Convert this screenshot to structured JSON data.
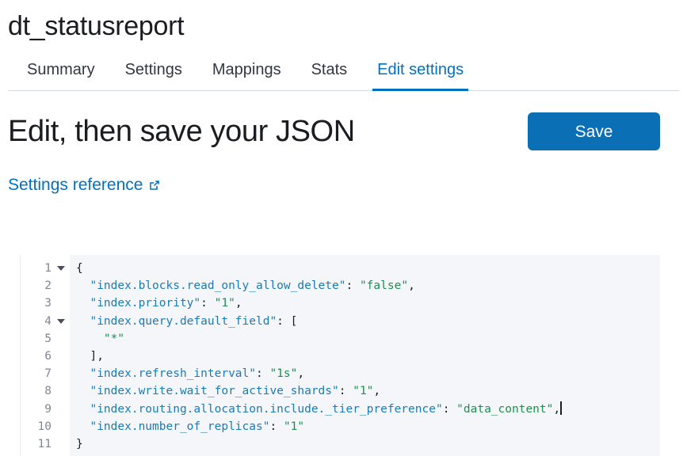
{
  "header": {
    "index_name": "dt_statusreport"
  },
  "tabs": [
    {
      "label": "Summary",
      "active": false
    },
    {
      "label": "Settings",
      "active": false
    },
    {
      "label": "Mappings",
      "active": false
    },
    {
      "label": "Stats",
      "active": false
    },
    {
      "label": "Edit settings",
      "active": true
    }
  ],
  "section": {
    "title": "Edit, then save your JSON",
    "save_label": "Save",
    "reference_link_label": "Settings reference",
    "reference_link_icon": "external-link-icon"
  },
  "editor": {
    "caret_line": 9,
    "fold_lines": [
      1,
      4
    ],
    "lines": [
      {
        "num": "1",
        "indent": 0,
        "tokens": [
          {
            "t": "p",
            "s": "{"
          }
        ]
      },
      {
        "num": "2",
        "indent": 2,
        "tokens": [
          {
            "t": "k",
            "s": "\"index.blocks.read_only_allow_delete\""
          },
          {
            "t": "p",
            "s": ": "
          },
          {
            "t": "v",
            "s": "\"false\""
          },
          {
            "t": "p",
            "s": ","
          }
        ]
      },
      {
        "num": "3",
        "indent": 2,
        "tokens": [
          {
            "t": "k",
            "s": "\"index.priority\""
          },
          {
            "t": "p",
            "s": ": "
          },
          {
            "t": "v",
            "s": "\"1\""
          },
          {
            "t": "p",
            "s": ","
          }
        ]
      },
      {
        "num": "4",
        "indent": 2,
        "tokens": [
          {
            "t": "k",
            "s": "\"index.query.default_field\""
          },
          {
            "t": "p",
            "s": ": ["
          }
        ]
      },
      {
        "num": "5",
        "indent": 4,
        "tokens": [
          {
            "t": "v",
            "s": "\"*\""
          }
        ]
      },
      {
        "num": "6",
        "indent": 2,
        "tokens": [
          {
            "t": "p",
            "s": "],"
          }
        ]
      },
      {
        "num": "7",
        "indent": 2,
        "tokens": [
          {
            "t": "k",
            "s": "\"index.refresh_interval\""
          },
          {
            "t": "p",
            "s": ": "
          },
          {
            "t": "v",
            "s": "\"1s\""
          },
          {
            "t": "p",
            "s": ","
          }
        ]
      },
      {
        "num": "8",
        "indent": 2,
        "tokens": [
          {
            "t": "k",
            "s": "\"index.write.wait_for_active_shards\""
          },
          {
            "t": "p",
            "s": ": "
          },
          {
            "t": "v",
            "s": "\"1\""
          },
          {
            "t": "p",
            "s": ","
          }
        ]
      },
      {
        "num": "9",
        "indent": 2,
        "tokens": [
          {
            "t": "k",
            "s": "\"index.routing.allocation.include._tier_preference\""
          },
          {
            "t": "p",
            "s": ": "
          },
          {
            "t": "v",
            "s": "\"data_content\""
          },
          {
            "t": "p",
            "s": ","
          }
        ]
      },
      {
        "num": "10",
        "indent": 2,
        "tokens": [
          {
            "t": "k",
            "s": "\"index.number_of_replicas\""
          },
          {
            "t": "p",
            "s": ": "
          },
          {
            "t": "v",
            "s": "\"1\""
          }
        ]
      },
      {
        "num": "11",
        "indent": 0,
        "tokens": [
          {
            "t": "p",
            "s": "}"
          }
        ]
      }
    ]
  },
  "colors": {
    "accent": "#0071c2",
    "save_button": "#0a6fb4",
    "json_key": "#1b7bb5",
    "json_string": "#1e8f4e",
    "editor_background": "#f4f6fa",
    "border": "#d3dae6"
  }
}
